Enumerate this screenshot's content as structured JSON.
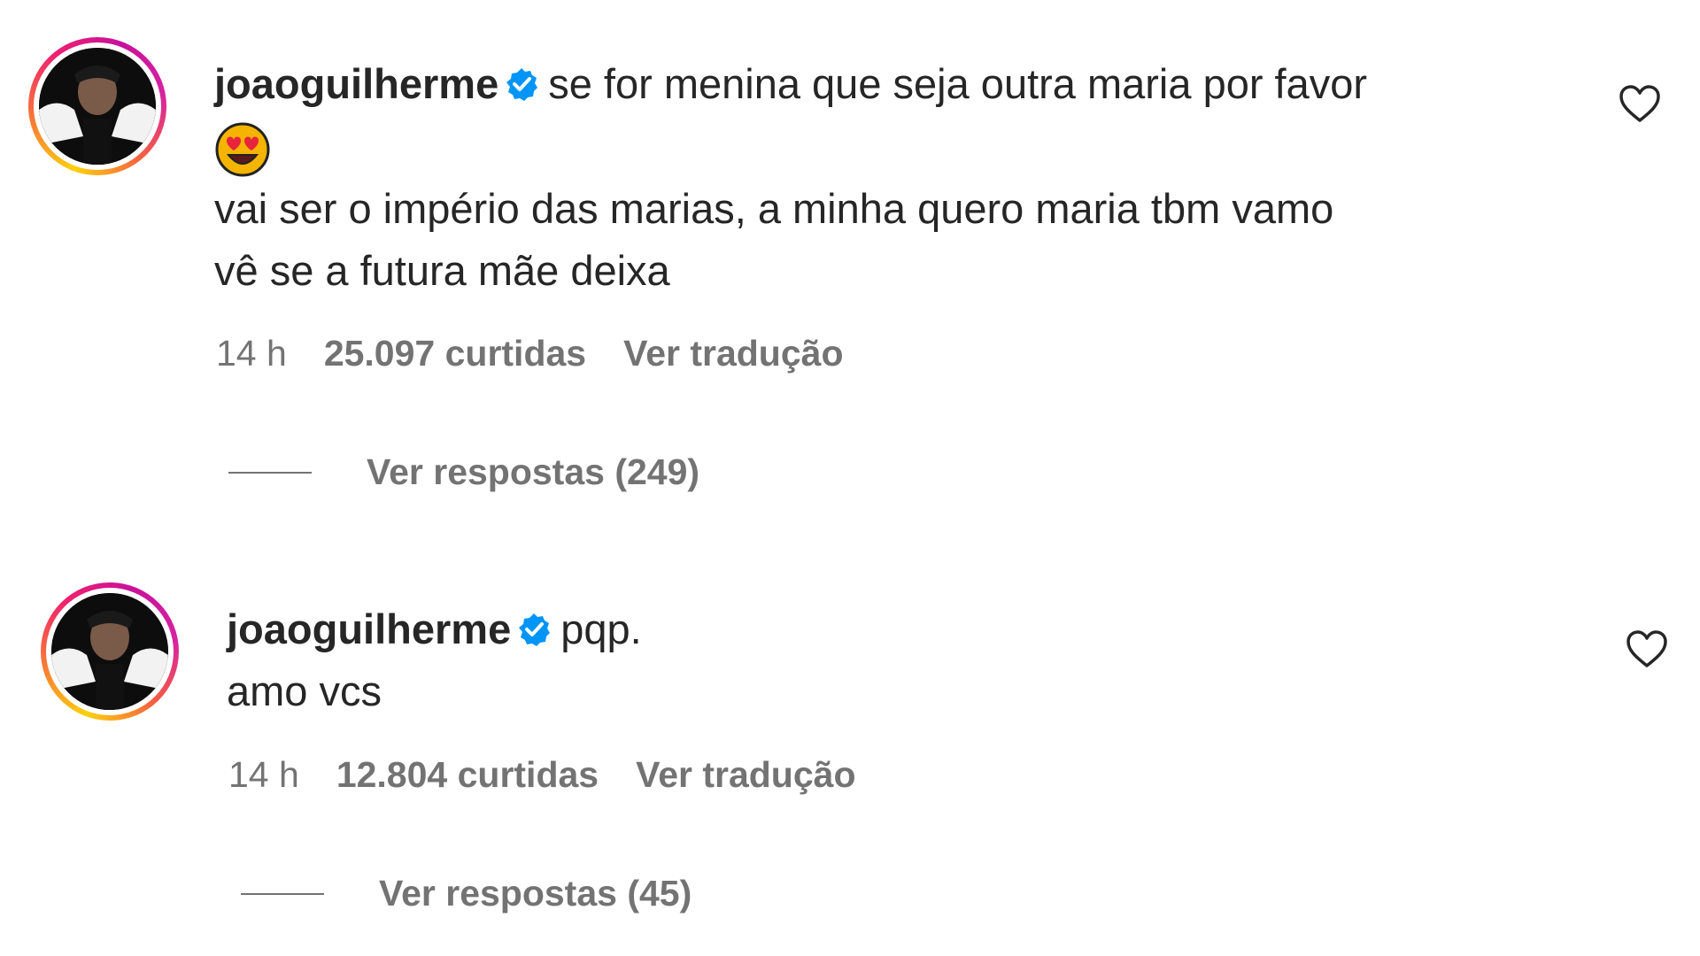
{
  "comments": [
    {
      "username": "joaoguilherme",
      "text": "se for menina que seja outra maria por favor",
      "emoji": "heart-eyes-emoji",
      "text_line2": "vai ser o império das marias, a minha quero maria tbm vamo",
      "text_line3": "vê se a futura mãe deixa",
      "time": "14 h",
      "likes": "25.097 curtidas",
      "translate": "Ver tradução",
      "replies": "Ver respostas (249)"
    },
    {
      "username": "joaoguilherme",
      "text": "pqp.",
      "text_line2": "amo vcs",
      "time": "14 h",
      "likes": "12.804 curtidas",
      "translate": "Ver tradução",
      "replies": "Ver respostas (45)"
    }
  ],
  "colors": {
    "text": "#262626",
    "secondary": "#737373",
    "verified": "#0095f6"
  }
}
